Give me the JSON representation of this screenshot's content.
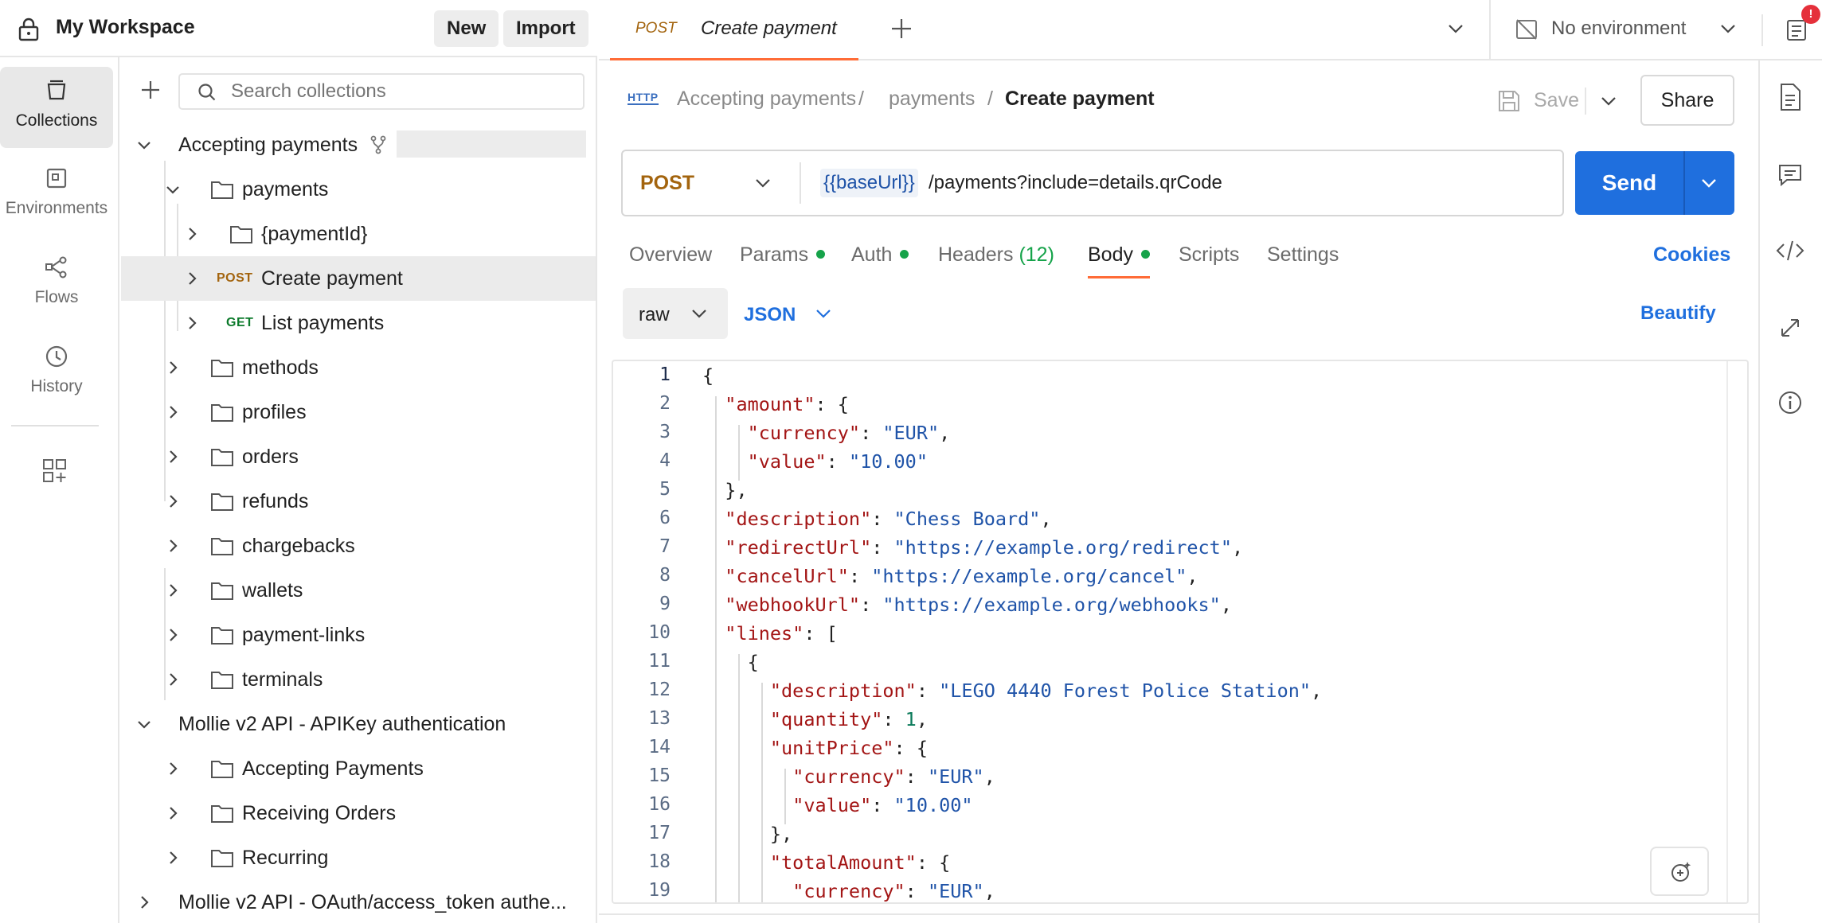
{
  "workspace": {
    "title": "My Workspace",
    "new_label": "New",
    "import_label": "Import"
  },
  "rail": {
    "items": [
      {
        "label": "Collections",
        "icon": "collections-icon",
        "active": true
      },
      {
        "label": "Environments",
        "icon": "environments-icon"
      },
      {
        "label": "Flows",
        "icon": "flows-icon"
      },
      {
        "label": "History",
        "icon": "history-icon"
      }
    ]
  },
  "sidebar": {
    "search_placeholder": "Search collections",
    "tree": [
      {
        "label": "Accepting payments",
        "type": "collection",
        "expanded": true
      },
      {
        "label": "payments",
        "type": "folder",
        "expanded": true
      },
      {
        "label": "{paymentId}",
        "type": "folder"
      },
      {
        "label": "Create payment",
        "type": "request",
        "method": "POST",
        "selected": true
      },
      {
        "label": "List payments",
        "type": "request",
        "method": "GET"
      },
      {
        "label": "methods",
        "type": "folder"
      },
      {
        "label": "profiles",
        "type": "folder"
      },
      {
        "label": "orders",
        "type": "folder"
      },
      {
        "label": "refunds",
        "type": "folder"
      },
      {
        "label": "chargebacks",
        "type": "folder"
      },
      {
        "label": "wallets",
        "type": "folder"
      },
      {
        "label": "payment-links",
        "type": "folder"
      },
      {
        "label": "terminals",
        "type": "folder"
      },
      {
        "label": "Mollie v2 API - APIKey authentication",
        "type": "collection",
        "expanded": true
      },
      {
        "label": "Accepting Payments",
        "type": "folder"
      },
      {
        "label": "Receiving Orders",
        "type": "folder"
      },
      {
        "label": "Recurring",
        "type": "folder"
      },
      {
        "label": "Mollie v2 API - OAuth/access_token authe...",
        "type": "collection"
      }
    ]
  },
  "tabs": {
    "active": {
      "method": "POST",
      "title": "Create payment"
    },
    "environment": "No environment",
    "notification_badge": "!"
  },
  "breadcrumb": {
    "badge": "HTTP",
    "parts": [
      "Accepting payments",
      "payments",
      "Create payment"
    ],
    "separator": "/",
    "save_label": "Save",
    "share_label": "Share"
  },
  "request": {
    "method": "POST",
    "url_variable": "{{baseUrl}}",
    "url_path": "/payments?include=details.qrCode",
    "send_label": "Send"
  },
  "request_tabs": {
    "overview": "Overview",
    "params": "Params",
    "auth": "Auth",
    "headers": "Headers",
    "headers_count": "(12)",
    "body": "Body",
    "scripts": "Scripts",
    "settings": "Settings",
    "cookies": "Cookies"
  },
  "body_options": {
    "mode": "raw",
    "format": "JSON",
    "beautify": "Beautify"
  },
  "colors": {
    "accent": "#ff6c37",
    "blue": "#1f6fde",
    "post": "#a3640e",
    "get": "#0c7a2b",
    "green_dot": "#16a34a"
  },
  "code_lines": [
    [
      [
        "p",
        "{"
      ]
    ],
    [
      [
        "p",
        "  "
      ],
      [
        "k",
        "\"amount\""
      ],
      [
        "p",
        ": {"
      ]
    ],
    [
      [
        "p",
        "    "
      ],
      [
        "k",
        "\"currency\""
      ],
      [
        "p",
        ": "
      ],
      [
        "s",
        "\"EUR\""
      ],
      [
        "p",
        ","
      ]
    ],
    [
      [
        "p",
        "    "
      ],
      [
        "k",
        "\"value\""
      ],
      [
        "p",
        ": "
      ],
      [
        "s",
        "\"10.00\""
      ]
    ],
    [
      [
        "p",
        "  },"
      ]
    ],
    [
      [
        "p",
        "  "
      ],
      [
        "k",
        "\"description\""
      ],
      [
        "p",
        ": "
      ],
      [
        "s",
        "\"Chess Board\""
      ],
      [
        "p",
        ","
      ]
    ],
    [
      [
        "p",
        "  "
      ],
      [
        "k",
        "\"redirectUrl\""
      ],
      [
        "p",
        ": "
      ],
      [
        "s",
        "\"https://example.org/redirect\""
      ],
      [
        "p",
        ","
      ]
    ],
    [
      [
        "p",
        "  "
      ],
      [
        "k",
        "\"cancelUrl\""
      ],
      [
        "p",
        ": "
      ],
      [
        "s",
        "\"https://example.org/cancel\""
      ],
      [
        "p",
        ","
      ]
    ],
    [
      [
        "p",
        "  "
      ],
      [
        "k",
        "\"webhookUrl\""
      ],
      [
        "p",
        ": "
      ],
      [
        "s",
        "\"https://example.org/webhooks\""
      ],
      [
        "p",
        ","
      ]
    ],
    [
      [
        "p",
        "  "
      ],
      [
        "k",
        "\"lines\""
      ],
      [
        "p",
        ": ["
      ]
    ],
    [
      [
        "p",
        "    {"
      ]
    ],
    [
      [
        "p",
        "      "
      ],
      [
        "k",
        "\"description\""
      ],
      [
        "p",
        ": "
      ],
      [
        "s",
        "\"LEGO 4440 Forest Police Station\""
      ],
      [
        "p",
        ","
      ]
    ],
    [
      [
        "p",
        "      "
      ],
      [
        "k",
        "\"quantity\""
      ],
      [
        "p",
        ": "
      ],
      [
        "n",
        "1"
      ],
      [
        "p",
        ","
      ]
    ],
    [
      [
        "p",
        "      "
      ],
      [
        "k",
        "\"unitPrice\""
      ],
      [
        "p",
        ": {"
      ]
    ],
    [
      [
        "p",
        "        "
      ],
      [
        "k",
        "\"currency\""
      ],
      [
        "p",
        ": "
      ],
      [
        "s",
        "\"EUR\""
      ],
      [
        "p",
        ","
      ]
    ],
    [
      [
        "p",
        "        "
      ],
      [
        "k",
        "\"value\""
      ],
      [
        "p",
        ": "
      ],
      [
        "s",
        "\"10.00\""
      ]
    ],
    [
      [
        "p",
        "      },"
      ]
    ],
    [
      [
        "p",
        "      "
      ],
      [
        "k",
        "\"totalAmount\""
      ],
      [
        "p",
        ": {"
      ]
    ],
    [
      [
        "p",
        "        "
      ],
      [
        "k",
        "\"currency\""
      ],
      [
        "p",
        ": "
      ],
      [
        "s",
        "\"EUR\""
      ],
      [
        "p",
        ","
      ]
    ]
  ]
}
